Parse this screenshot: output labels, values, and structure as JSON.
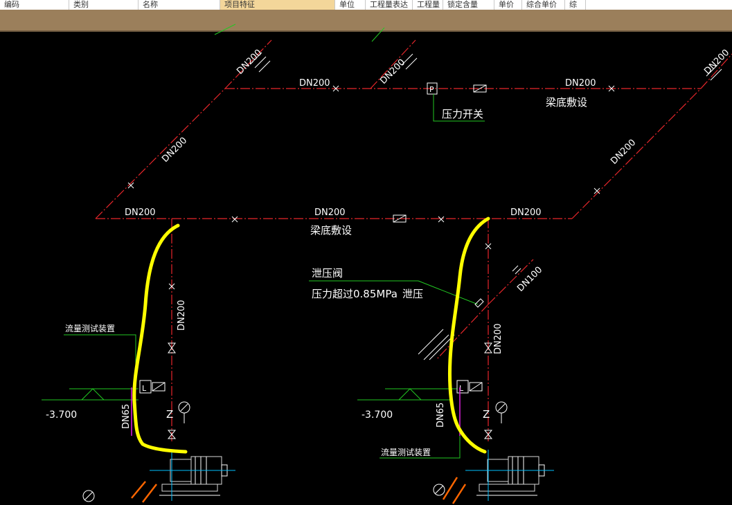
{
  "table_header": {
    "columns": [
      "编码",
      "类别",
      "名称",
      "项目特征",
      "单位",
      "工程量表达",
      "工程量",
      "锁定含量",
      "单价",
      "综合单价",
      "综"
    ]
  },
  "drawing": {
    "pipe_labels": {
      "dn200": "DN200",
      "dn100": "DN100",
      "dn65": "DN65"
    },
    "beam_note": "梁底敷设",
    "pressure_switch": "压力开关",
    "pressure_switch_symbol": "P",
    "relief_valve": "泄压阀",
    "relief_note": "压力超过0.85MPa",
    "relief_word": "泄压",
    "flow_test_device": "流量测试装置",
    "elevation": "-3.700",
    "valve_mark": "Z",
    "flow_meter_mark": "L",
    "colors": {
      "background": "#000000",
      "pipe": "#e8262b",
      "leader": "#22c822",
      "highlight": "#ffff00",
      "pump": "#d9d9d9",
      "orange": "#ff6600",
      "magenta": "#e020e0"
    }
  }
}
